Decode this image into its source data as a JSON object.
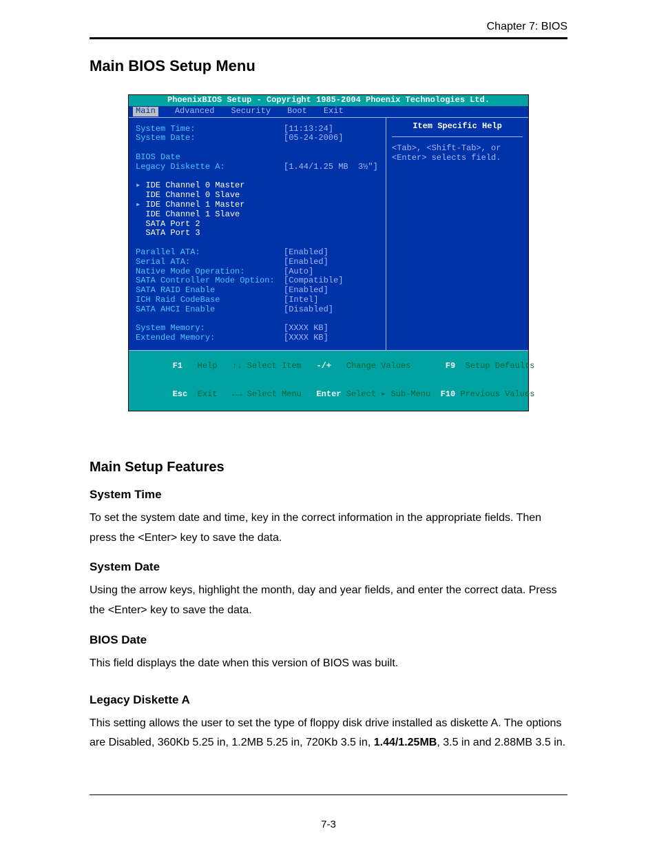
{
  "header": {
    "chapter": "Chapter 7: BIOS"
  },
  "page": {
    "title": "Main BIOS Setup Menu",
    "number": "7-3"
  },
  "bios": {
    "title": "PhoenixBIOS Setup - Copyright 1985-2004 Phoenix Technologies Ltd.",
    "tabs": [
      "Main",
      "Advanced",
      "Security",
      "Boot",
      "Exit"
    ],
    "rows": {
      "system_time_l": "System Time:",
      "system_time_v": "[11:13:24]",
      "system_date_l": "System Date:",
      "system_date_v": "[05-24-2006]",
      "bios_date_l": "BIOS Date",
      "legacy_a_l": "Legacy Diskette A:",
      "legacy_a_v": "[1.44/1.25 MB  3½\"]",
      "ide0m": "IDE Channel 0 Master",
      "ide0s": "IDE Channel 0 Slave",
      "ide1m": "IDE Channel 1 Master",
      "ide1s": "IDE Channel 1 Slave",
      "sata2": "SATA Port 2",
      "sata3": "SATA Port 3",
      "pata_l": "Parallel ATA:",
      "pata_v": "[Enabled]",
      "sata_l": "Serial ATA:",
      "sata_v": "[Enabled]",
      "native_l": "Native Mode Operation:",
      "native_v": "[Auto]",
      "sctrl_l": "SATA Controller Mode Option:",
      "sctrl_v": "[Compatible]",
      "sraid_l": "SATA RAID Enable",
      "sraid_v": "[Enabled]",
      "ich_l": "ICH Raid CodeBase",
      "ich_v": "[Intel]",
      "ahci_l": "SATA AHCI Enable",
      "ahci_v": "[Disabled]",
      "sysmem_l": "System Memory:",
      "sysmem_v": "[XXXX KB]",
      "extmem_l": "Extended Memory:",
      "extmem_v": "[XXXX KB]"
    },
    "help": {
      "title": "Item Specific Help",
      "body": "<Tab>, <Shift-Tab>, or <Enter> selects field."
    },
    "footer": {
      "l1a": "F1",
      "l1b": "Help",
      "l1c": "↑↓ Select Item",
      "l1d": "-/+",
      "l1e": "Change Values",
      "l1f": "F9",
      "l1g": "Setup Defaults",
      "l2a": "Esc",
      "l2b": "Exit",
      "l2c": "←→ Select Menu",
      "l2d": "Enter",
      "l2e": "Select ▸ Sub-Menu",
      "l2f": "F10",
      "l2g": "Previous Values"
    }
  },
  "features": {
    "title": "Main Setup Features",
    "system_time": {
      "h": "System Time",
      "p": "To set the system date and time, key in the correct information in the appropriate fields.  Then press the <Enter> key to save the data."
    },
    "system_date": {
      "h": "System Date",
      "p": "Using the arrow keys, highlight the month, day and year fields, and enter the correct data.  Press the <Enter> key to save the data."
    },
    "bios_date": {
      "h": "BIOS Date",
      "p": "This field displays the date when this version of BIOS was built."
    },
    "legacy_a": {
      "h": "Legacy Diskette A",
      "p1": "This setting allows the user to set the type of floppy disk drive installed as diskette A. The options are Disabled, 360Kb 5.25 in, 1.2MB 5.25 in, 720Kb 3.5 in, ",
      "bold": "1.44/1.25MB",
      "p2": ", 3.5 in and 2.88MB 3.5 in."
    }
  }
}
